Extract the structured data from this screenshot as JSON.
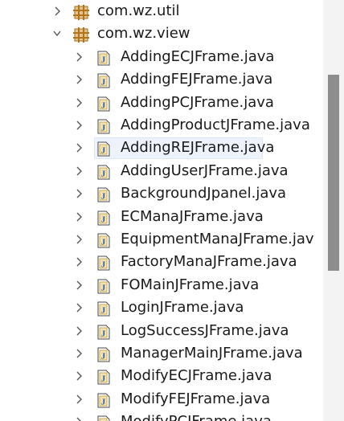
{
  "tree": {
    "items": [
      {
        "label": "com.wz.util",
        "kind": "package",
        "expanded": false
      },
      {
        "label": "com.wz.view",
        "kind": "package",
        "expanded": true
      },
      {
        "label": "AddingECJFrame.java",
        "kind": "java"
      },
      {
        "label": "AddingFEJFrame.java",
        "kind": "java"
      },
      {
        "label": "AddingPCJFrame.java",
        "kind": "java"
      },
      {
        "label": "AddingProductJFrame.java",
        "kind": "java"
      },
      {
        "label": "AddingREJFrame.java",
        "kind": "java",
        "selected": true
      },
      {
        "label": "AddingUserJFrame.java",
        "kind": "java"
      },
      {
        "label": "BackgroundJpanel.java",
        "kind": "java"
      },
      {
        "label": "ECManaJFrame.java",
        "kind": "java"
      },
      {
        "label": "EquipmentManaJFrame.jav",
        "kind": "java"
      },
      {
        "label": "FactoryManaJFrame.java",
        "kind": "java"
      },
      {
        "label": "FOMainJFrame.java",
        "kind": "java"
      },
      {
        "label": "LoginJFrame.java",
        "kind": "java"
      },
      {
        "label": "LogSuccessJFrame.java",
        "kind": "java"
      },
      {
        "label": "ManagerMainJFrame.java",
        "kind": "java"
      },
      {
        "label": "ModifyECJFrame.java",
        "kind": "java"
      },
      {
        "label": "ModifyFEJFrame.java",
        "kind": "java"
      },
      {
        "label": "ModifyPCJFrame.java",
        "kind": "java"
      }
    ]
  },
  "icons": {
    "collapsed": "chevron-right-icon",
    "expanded": "chevron-down-icon",
    "package": "package-icon",
    "java": "java-file-icon"
  },
  "colors": {
    "background": "#ffffff",
    "selection": "#eef3fb",
    "scrollbar_track": "#f3f3f3",
    "scrollbar_thumb": "#8d8d8d",
    "package_icon": "#b07a2a",
    "java_icon_blue": "#3a6fb0"
  },
  "scrollbar": {
    "position_fraction": 0.18,
    "visible_fraction": 0.47
  }
}
